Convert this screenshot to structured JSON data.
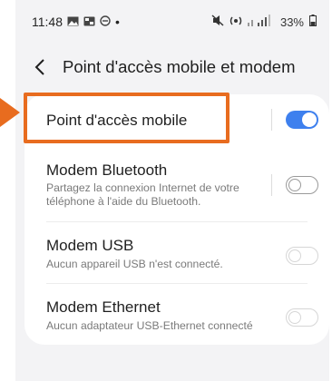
{
  "status_bar": {
    "time": "11:48",
    "dot": "•",
    "battery": "33%"
  },
  "header": {
    "title": "Point d'accès mobile et modem"
  },
  "rows": [
    {
      "label": "Point d'accès mobile",
      "sub": "",
      "toggle": "on"
    },
    {
      "label": "Modem Bluetooth",
      "sub": "Partagez la connexion Internet de votre téléphone à l'aide du Bluetooth.",
      "toggle": "off"
    },
    {
      "label": "Modem USB",
      "sub": "Aucun appareil USB n'est connecté.",
      "toggle": "disabled"
    },
    {
      "label": "Modem Ethernet",
      "sub": "Aucun adaptateur USB-Ethernet connecté",
      "toggle": "disabled"
    }
  ],
  "colors": {
    "accent": "#3e80ee",
    "highlight": "#e86c1f"
  }
}
